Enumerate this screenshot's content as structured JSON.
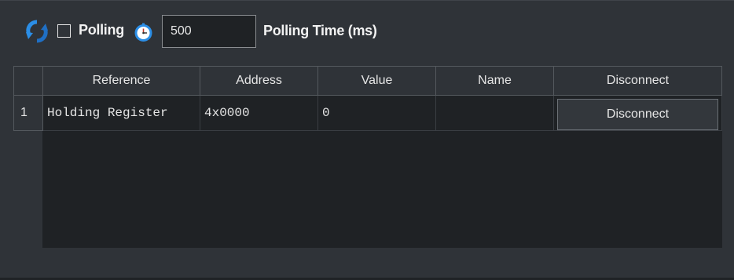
{
  "toolbar": {
    "refresh_icon": "refresh-icon",
    "polling_checked": false,
    "polling_label": "Polling",
    "timer_icon": "timer-icon",
    "polling_time_value": "500",
    "polling_time_label": "Polling Time (ms)"
  },
  "grid": {
    "columns": [
      "Reference",
      "Address",
      "Value",
      "Name",
      "Disconnect"
    ],
    "rows": [
      {
        "index": "1",
        "reference": "Holding Register",
        "address": "4x0000",
        "value": "0",
        "name": "",
        "button_label": "Disconnect"
      }
    ]
  },
  "colors": {
    "background": "#2f3338",
    "grid_background": "#1f2225",
    "icon_blue": "#2b8ee6"
  }
}
